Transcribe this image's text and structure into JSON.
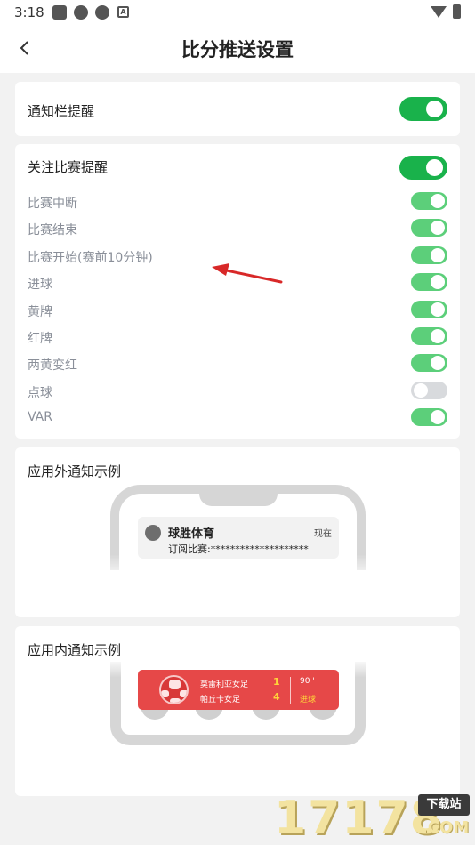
{
  "status_bar": {
    "time": "3:18",
    "a_icon": "A"
  },
  "header": {
    "title": "比分推送设置"
  },
  "notification_bar": {
    "label": "通知栏提醒",
    "enabled": true
  },
  "follow": {
    "label": "关注比赛提醒",
    "enabled": true,
    "items": [
      {
        "label": "比赛中断",
        "enabled": true
      },
      {
        "label": "比赛结束",
        "enabled": true
      },
      {
        "label": "比赛开始(赛前10分钟)",
        "enabled": true
      },
      {
        "label": "进球",
        "enabled": true
      },
      {
        "label": "黄牌",
        "enabled": true
      },
      {
        "label": "红牌",
        "enabled": true
      },
      {
        "label": "两黄变红",
        "enabled": true
      },
      {
        "label": "点球",
        "enabled": false
      },
      {
        "label": "VAR",
        "enabled": true
      }
    ]
  },
  "outside_example": {
    "title": "应用外通知示例",
    "app_name": "球胜体育",
    "time": "现在",
    "text": "订阅比赛:********************"
  },
  "inside_example": {
    "title": "应用内通知示例",
    "home_team": "莫雷利亚女足",
    "away_team": "帕丘卡女足",
    "home_score": "1",
    "away_score": "4",
    "minute": "90 '",
    "event": "进球"
  },
  "watermark": {
    "digits": "17178",
    "badge": "下载站",
    "domain": ".COM"
  },
  "colors": {
    "toggle_on": "#19b24b",
    "toggle_sub_on": "#5ccf7a",
    "toggle_off": "#d8dadd",
    "banner": "#e64848"
  }
}
